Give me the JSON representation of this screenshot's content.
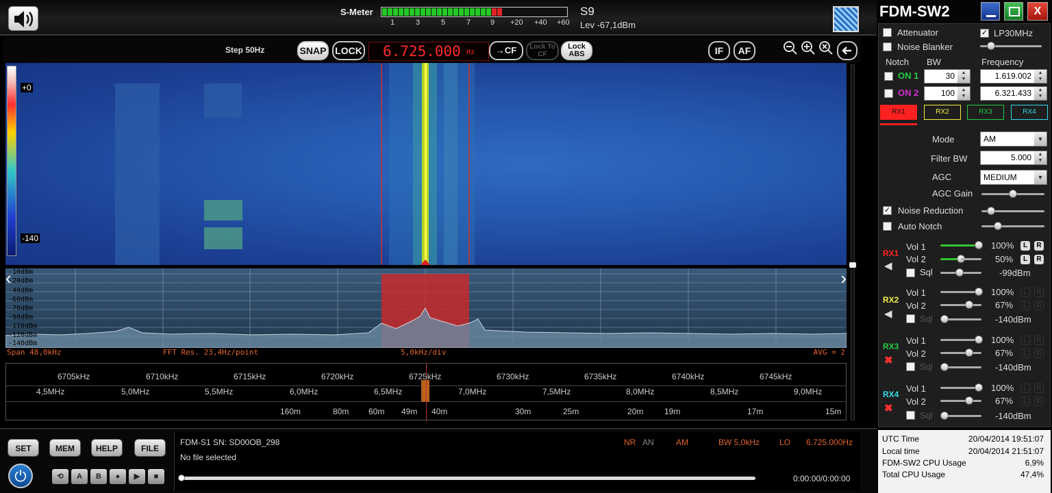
{
  "smeter": {
    "label": "S-Meter",
    "ticks": [
      "1",
      "3",
      "5",
      "7",
      "9",
      "+20",
      "+40",
      "+60"
    ],
    "s_value": "S9",
    "level": "Lev -67,1dBm"
  },
  "controls": {
    "step": "Step 50Hz",
    "snap": "SNAP",
    "lock": "LOCK",
    "frequency": "6.725.000",
    "freq_unit": "Hz",
    "to_cf": "→CF",
    "lock_to_cf": "Lock To CF",
    "lock_abs": "Lock ABS",
    "if": "IF",
    "af": "AF"
  },
  "waterfall": {
    "scale_top": "+0",
    "scale_bottom": "-140"
  },
  "spectrum": {
    "db_labels": [
      "-10dBm",
      "-20dBm",
      "-40dBm",
      "-60dBm",
      "-70dBm",
      "-90dBm",
      "-110dBm",
      "-120dBm",
      "-140dBm"
    ],
    "span": "Span 48,0kHz",
    "fft_res": "FFT Res. 23,4Hz/point",
    "div": "5,0kHz/div",
    "avg": "AVG = 2"
  },
  "scale": {
    "khz": [
      "6705kHz",
      "6710kHz",
      "6715kHz",
      "6720kHz",
      "6725kHz",
      "6730kHz",
      "6735kHz",
      "6740kHz",
      "6745kHz"
    ],
    "mhz": [
      "4,5MHz",
      "5,0MHz",
      "5,5MHz",
      "6,0MHz",
      "6,5MHz",
      "7,0MHz",
      "7,5MHz",
      "8,0MHz",
      "8,5MHz",
      "9,0MHz"
    ],
    "bands": [
      "160m",
      "80m",
      "60m",
      "49m",
      "40m",
      "30m",
      "25m",
      "20m",
      "19m",
      "17m",
      "15m"
    ]
  },
  "bottom": {
    "buttons": [
      "SET",
      "MEM",
      "HELP",
      "FILE"
    ],
    "small_buttons": [
      "A",
      "B"
    ],
    "device": "FDM-S1 SN: SD00OB_298",
    "file": "No file selected",
    "nr": "NR",
    "an": "AN",
    "mode": "AM",
    "bw": "BW 5,0kHz",
    "lo_label": "LO",
    "lo_value": "6.725.000Hz",
    "time": "0:00:00/0:00:00"
  },
  "panel": {
    "title": "FDM-SW2",
    "attenuator": "Attenuator",
    "lp30": "LP30MHz",
    "noise_blanker": "Noise Blanker",
    "notch": "Notch",
    "bw_header": "BW",
    "freq_header": "Frequency",
    "notch1": {
      "label": "ON 1",
      "bw": "30",
      "freq": "1.619.002"
    },
    "notch2": {
      "label": "ON 2",
      "bw": "100",
      "freq": "6.321.433"
    },
    "rx_tabs": [
      "RX1",
      "RX2",
      "RX3",
      "RX4"
    ],
    "mode_label": "Mode",
    "mode_value": "AM",
    "filter_bw_label": "Filter BW",
    "filter_bw_value": "5.000",
    "agc_label": "AGC",
    "agc_value": "MEDIUM",
    "agc_gain": "AGC Gain",
    "noise_reduction": "Noise Reduction",
    "auto_notch": "Auto Notch",
    "vol1": "Vol 1",
    "vol2": "Vol 2",
    "sql": "Sql",
    "rx1": {
      "label": "RX1",
      "vol1": "100%",
      "vol2": "50%",
      "sql": "-99dBm"
    },
    "rx2": {
      "label": "RX2",
      "vol1": "100%",
      "vol2": "67%",
      "sql": "-140dBm"
    },
    "rx3": {
      "label": "RX3",
      "vol1": "100%",
      "vol2": "67%",
      "sql": "-140dBm"
    },
    "rx4": {
      "label": "RX4",
      "vol1": "100%",
      "vol2": "67%",
      "sql": "-140dBm"
    },
    "L": "L",
    "R": "R"
  },
  "sysinfo": {
    "utc_label": "UTC Time",
    "utc_value": "20/04/2014 19:51:07",
    "local_label": "Local time",
    "local_value": "20/04/2014 21:51:07",
    "cpu_label": "FDM-SW2 CPU Usage",
    "cpu_value": "6,9%",
    "total_label": "Total CPU Usage",
    "total_value": "47,4%"
  },
  "colors": {
    "rx1": "#ff2020",
    "rx2": "#f0f040",
    "rx3": "#22cc44",
    "rx4": "#30d8e8",
    "accent_green": "#2fc52f"
  }
}
